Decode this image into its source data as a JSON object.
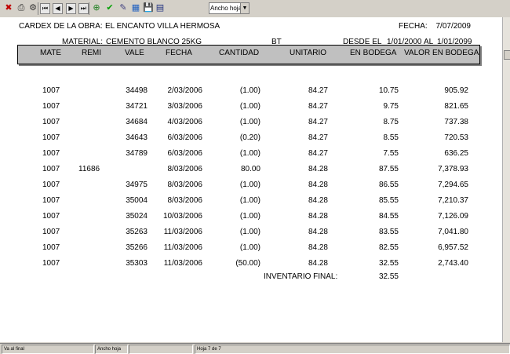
{
  "toolbar": {
    "buttons": [
      {
        "name": "close-icon",
        "glyph": "✖",
        "color": "#c00000"
      },
      {
        "name": "print-icon",
        "glyph": "⎙",
        "color": "#303030"
      },
      {
        "name": "print-setup-icon",
        "glyph": "⚙",
        "color": "#303030"
      },
      {
        "name": "first-page-icon",
        "glyph": "⏮",
        "color": "#000"
      },
      {
        "name": "prev-page-icon",
        "glyph": "◀",
        "color": "#000"
      },
      {
        "name": "next-page-icon",
        "glyph": "▶",
        "color": "#000"
      },
      {
        "name": "last-page-icon",
        "glyph": "⏭",
        "color": "#000"
      },
      {
        "name": "zoom-icon",
        "glyph": "⊕",
        "color": "#208020"
      },
      {
        "name": "check-icon",
        "glyph": "✔",
        "color": "#00a000"
      },
      {
        "name": "brush-icon",
        "glyph": "✎",
        "color": "#404080"
      },
      {
        "name": "grid-icon",
        "glyph": "▦",
        "color": "#2060c0"
      },
      {
        "name": "save-icon",
        "glyph": "💾",
        "color": "#203080"
      },
      {
        "name": "export-icon",
        "glyph": "▤",
        "color": "#203080"
      }
    ],
    "zoom_value": "Ancho hoja"
  },
  "report": {
    "obra_label": "CARDEX DE LA OBRA:",
    "obra_value": "EL ENCANTO VILLA HERMOSA",
    "fecha_label": "FECHA:",
    "fecha_value": "7/07/2009",
    "material_label": "MATERIAL:",
    "material_value": "CEMENTO BLANCO 25KG",
    "unit": "BT",
    "desde_label": "DESDE EL",
    "desde_value": "1/01/2000",
    "al_label": "AL",
    "al_value": "1/01/2099",
    "columns": {
      "mate": "MATE",
      "remi": "REMI",
      "vale": "VALE",
      "fecha": "FECHA",
      "cantidad": "CANTIDAD",
      "unitario": "UNITARIO",
      "en_bodega": "EN BODEGA",
      "valor_en_bodega": "VALOR EN BODEGA"
    },
    "rows": [
      {
        "mate": "1007",
        "remi": "",
        "vale": "34498",
        "fecha": "2/03/2006",
        "cantidad": "(1.00)",
        "unitario": "84.27",
        "en_bodega": "10.75",
        "valor": "905.92"
      },
      {
        "mate": "1007",
        "remi": "",
        "vale": "34721",
        "fecha": "3/03/2006",
        "cantidad": "(1.00)",
        "unitario": "84.27",
        "en_bodega": "9.75",
        "valor": "821.65"
      },
      {
        "mate": "1007",
        "remi": "",
        "vale": "34684",
        "fecha": "4/03/2006",
        "cantidad": "(1.00)",
        "unitario": "84.27",
        "en_bodega": "8.75",
        "valor": "737.38"
      },
      {
        "mate": "1007",
        "remi": "",
        "vale": "34643",
        "fecha": "6/03/2006",
        "cantidad": "(0.20)",
        "unitario": "84.27",
        "en_bodega": "8.55",
        "valor": "720.53"
      },
      {
        "mate": "1007",
        "remi": "",
        "vale": "34789",
        "fecha": "6/03/2006",
        "cantidad": "(1.00)",
        "unitario": "84.27",
        "en_bodega": "7.55",
        "valor": "636.25"
      },
      {
        "mate": "1007",
        "remi": "11686",
        "vale": "",
        "fecha": "8/03/2006",
        "cantidad": "80.00",
        "unitario": "84.28",
        "en_bodega": "87.55",
        "valor": "7,378.93"
      },
      {
        "mate": "1007",
        "remi": "",
        "vale": "34975",
        "fecha": "8/03/2006",
        "cantidad": "(1.00)",
        "unitario": "84.28",
        "en_bodega": "86.55",
        "valor": "7,294.65"
      },
      {
        "mate": "1007",
        "remi": "",
        "vale": "35004",
        "fecha": "8/03/2006",
        "cantidad": "(1.00)",
        "unitario": "84.28",
        "en_bodega": "85.55",
        "valor": "7,210.37"
      },
      {
        "mate": "1007",
        "remi": "",
        "vale": "35024",
        "fecha": "10/03/2006",
        "cantidad": "(1.00)",
        "unitario": "84.28",
        "en_bodega": "84.55",
        "valor": "7,126.09"
      },
      {
        "mate": "1007",
        "remi": "",
        "vale": "35263",
        "fecha": "11/03/2006",
        "cantidad": "(1.00)",
        "unitario": "84.28",
        "en_bodega": "83.55",
        "valor": "7,041.80"
      },
      {
        "mate": "1007",
        "remi": "",
        "vale": "35266",
        "fecha": "11/03/2006",
        "cantidad": "(1.00)",
        "unitario": "84.28",
        "en_bodega": "82.55",
        "valor": "6,957.52"
      },
      {
        "mate": "1007",
        "remi": "",
        "vale": "35303",
        "fecha": "11/03/2006",
        "cantidad": "(50.00)",
        "unitario": "84.28",
        "en_bodega": "32.55",
        "valor": "2,743.40"
      }
    ],
    "inventario_label": "INVENTARIO FINAL:",
    "inventario_value": "32.55"
  },
  "status": {
    "cell1": "Va al final",
    "cell2": "Ancho hoja",
    "cell3": "",
    "cell4": "Hoja 7 de 7"
  }
}
